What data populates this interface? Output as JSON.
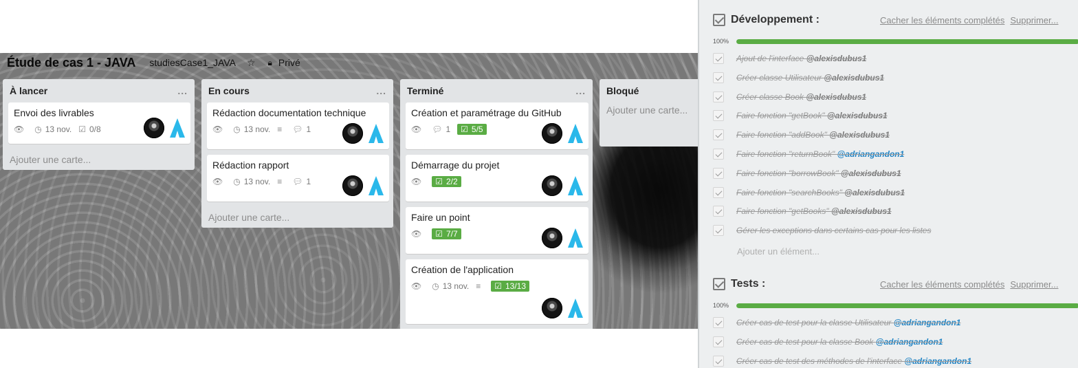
{
  "board": {
    "title": "Étude de cas 1 - JAVA",
    "org": "studiesCase1_JAVA",
    "visibility": "Privé",
    "star_icon": "star-icon",
    "lock_icon": "lock-icon"
  },
  "lists": [
    {
      "name": "À lancer",
      "menu": "...",
      "add_card": "Ajouter une carte...",
      "cards": [
        {
          "title": "Envoi des livrables",
          "date": "13 nov.",
          "checklist": "0/8"
        }
      ]
    },
    {
      "name": "En cours",
      "menu": "...",
      "add_card": "Ajouter une carte...",
      "cards": [
        {
          "title": "Rédaction documentation technique",
          "date": "13 nov.",
          "comments": "1"
        },
        {
          "title": "Rédaction rapport",
          "date": "13 nov.",
          "comments": "1"
        }
      ]
    },
    {
      "name": "Terminé",
      "menu": "...",
      "cards": [
        {
          "title": "Création et paramétrage du GitHub",
          "comments": "1",
          "checklist": "5/5"
        },
        {
          "title": "Démarrage du projet",
          "checklist": "2/2"
        },
        {
          "title": "Faire un point",
          "checklist": "7/7"
        },
        {
          "title": "Création de l'application",
          "date": "13 nov.",
          "checklist": "13/13"
        }
      ]
    },
    {
      "name": "Bloqué",
      "add_card": "Ajouter une carte..."
    }
  ],
  "checklists": [
    {
      "title": "Développement :",
      "hide_link": "Cacher les éléments complétés",
      "delete_link": "Supprimer...",
      "percent_label": "100%",
      "progress": 1.0,
      "items": [
        {
          "text": "Ajout de l'interface ",
          "mention": "@alexisdubus1",
          "me": false
        },
        {
          "text": "Créer classe Utilisateur ",
          "mention": "@alexisdubus1",
          "me": false
        },
        {
          "text": "Créer classe Book ",
          "mention": "@alexisdubus1",
          "me": false
        },
        {
          "text": "Faire fonction \"getBook\" ",
          "mention": "@alexisdubus1",
          "me": false
        },
        {
          "text": "Faire fonction \"addBook\" ",
          "mention": "@alexisdubus1",
          "me": false
        },
        {
          "text": "Faire fonction \"returnBook\" ",
          "mention": "@adriangandon1",
          "me": true
        },
        {
          "text": "Faire fonction \"borrowBook\" ",
          "mention": "@alexisdubus1",
          "me": false
        },
        {
          "text": "Faire fonction \"searchBooks\" ",
          "mention": "@alexisdubus1",
          "me": false
        },
        {
          "text": "Faire fonction \"getBooks\" ",
          "mention": "@alexisdubus1",
          "me": false
        },
        {
          "text": "Gérer les exceptions dans certains cas pour les listes",
          "mention": "",
          "me": false
        }
      ],
      "add_item": "Ajouter un élément..."
    },
    {
      "title": "Tests :",
      "hide_link": "Cacher les éléments complétés",
      "delete_link": "Supprimer...",
      "percent_label": "100%",
      "progress": 1.0,
      "items": [
        {
          "text": "Créer cas de test pour la classe Utilisateur ",
          "mention": "@adriangandon1",
          "me": true
        },
        {
          "text": "Créer cas de test pour la classe Book ",
          "mention": "@adriangandon1",
          "me": true
        },
        {
          "text": "Créer cas de test des méthodes de l'interface ",
          "mention": "@adriangandon1",
          "me": true
        }
      ]
    }
  ],
  "colors": {
    "label_green": "#5aac44",
    "mention_blue": "#2184c4",
    "logo_blue": "#2ab8ea"
  }
}
